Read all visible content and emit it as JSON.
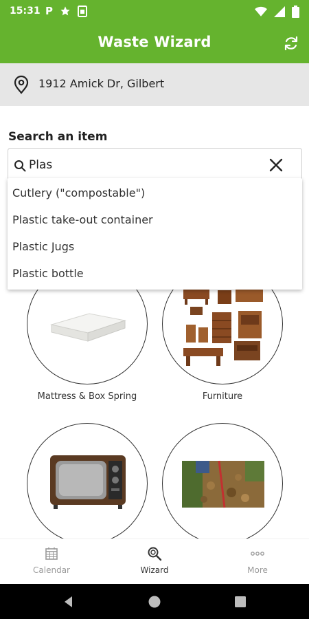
{
  "status_bar": {
    "time": "15:31",
    "left_icons": [
      "parking-icon",
      "star-icon",
      "sim-card-icon"
    ],
    "right_icons": [
      "wifi-icon",
      "signal-icon",
      "battery-icon"
    ],
    "p_glyph": "P"
  },
  "app_bar": {
    "title": "Waste Wizard",
    "action_icon": "refresh-icon"
  },
  "address": {
    "icon": "location-pin-icon",
    "text": "1912 Amick Dr, Gilbert"
  },
  "search": {
    "label": "Search an item",
    "value": "Plas",
    "suggestions": [
      "Cutlery (\"compostable\")",
      "Plastic take-out container",
      "Plastic Jugs",
      "Plastic bottle"
    ]
  },
  "categories": [
    {
      "label": "Mattress & Box Spring",
      "image": "mattress-image"
    },
    {
      "label": "Furniture",
      "image": "furniture-image"
    },
    {
      "label": "",
      "image": "television-image"
    },
    {
      "label": "",
      "image": "yard-waste-image"
    }
  ],
  "bottom_nav": [
    {
      "label": "Calendar",
      "icon": "calendar-icon",
      "active": false
    },
    {
      "label": "Wizard",
      "icon": "wizard-search-icon",
      "active": true
    },
    {
      "label": "More",
      "icon": "more-icon",
      "active": false
    }
  ],
  "colors": {
    "brand": "#65b32e",
    "address_bg": "#e6e6e6"
  }
}
